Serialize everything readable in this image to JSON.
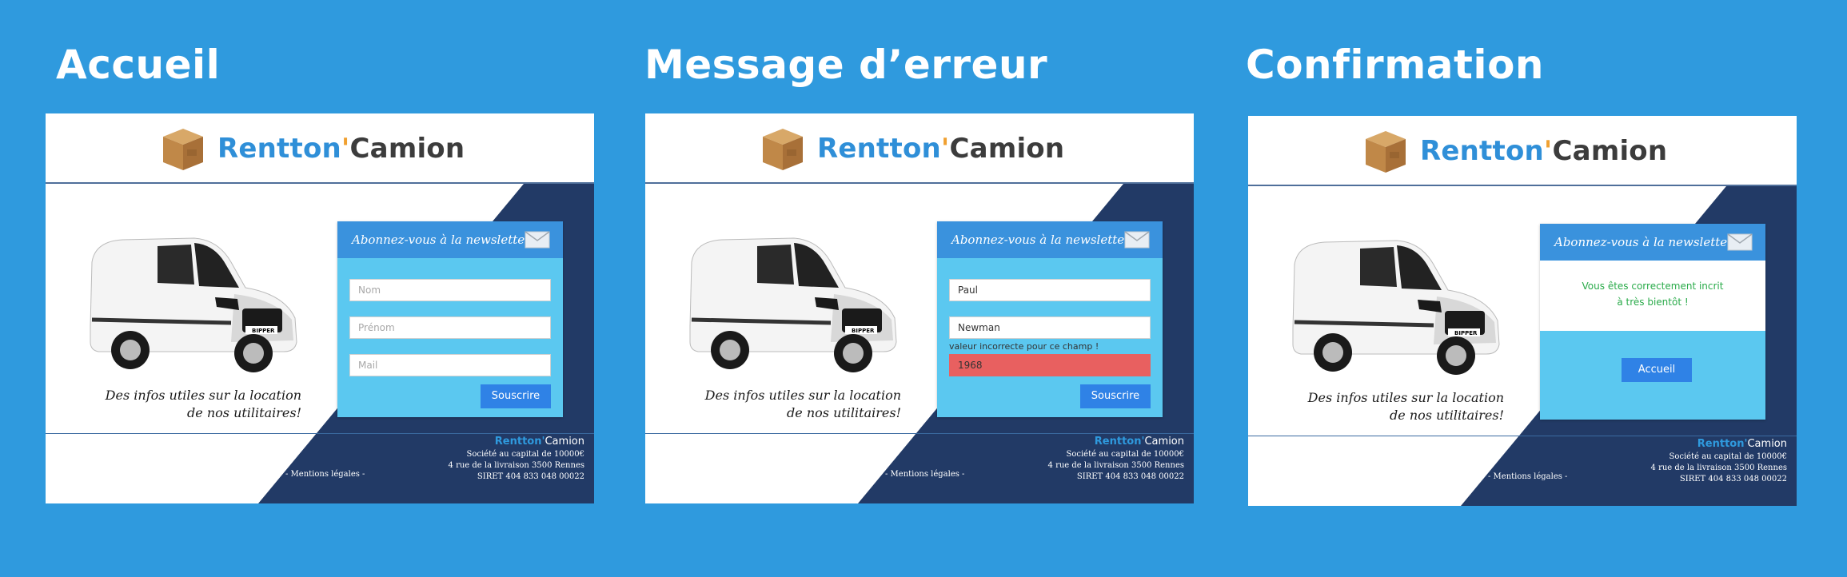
{
  "panels": [
    {
      "title": "Accueil",
      "brand": {
        "rent": "Rentton",
        "apos": "'",
        "camion": "Camion"
      },
      "tagline_line1": "Des infos utiles sur la location",
      "tagline_line2": "de nos utilitaires!",
      "newsletter_title": "Abonnez-vous à la newsletter",
      "fields": {
        "nom_placeholder": "Nom",
        "prenom_placeholder": "Prénom",
        "mail_placeholder": "Mail"
      },
      "submit_label": "Souscrire",
      "footer": {
        "capital": "Société au capital de 10000€",
        "address": "4 rue de la livraison 3500 Rennes",
        "siret": "SIRET 404 833 048 00022",
        "legal": "- Mentions légales -"
      }
    },
    {
      "title": "Message d’erreur",
      "brand": {
        "rent": "Rentton",
        "apos": "'",
        "camion": "Camion"
      },
      "tagline_line1": "Des infos utiles sur la location",
      "tagline_line2": "de nos utilitaires!",
      "newsletter_title": "Abonnez-vous à la newsletter",
      "fields": {
        "nom_value": "Paul",
        "prenom_value": "Newman",
        "error_message": "valeur incorrecte pour ce champ !",
        "mail_value": "1968"
      },
      "submit_label": "Souscrire",
      "footer": {
        "capital": "Société au capital de 10000€",
        "address": "4 rue de la livraison 3500 Rennes",
        "siret": "SIRET 404 833 048 00022",
        "legal": "- Mentions légales -"
      }
    },
    {
      "title": "Confirmation",
      "brand": {
        "rent": "Rentton",
        "apos": "'",
        "camion": "Camion"
      },
      "tagline_line1": "Des infos utiles sur la location",
      "tagline_line2": "de nos utilitaires!",
      "newsletter_title": "Abonnez-vous à la newsletter",
      "confirm_line1": "Vous êtes correctement incrit",
      "confirm_line2": "à très bientôt !",
      "home_label": "Accueil",
      "footer": {
        "capital": "Société au capital de 10000€",
        "address": "4 rue de la livraison 3500 Rennes",
        "siret": "SIRET 404 833 048 00022",
        "legal": "- Mentions légales -"
      }
    }
  ],
  "icons": {
    "logo": "cardboard-box-icon",
    "envelope": "envelope-icon",
    "van": "van-image"
  },
  "colors": {
    "page_bg": "#2f9ade",
    "navy": "#223a66",
    "brand_blue": "#2f8fd8",
    "header_blue": "#3a92dd",
    "form_bg": "#5bc8f0",
    "button": "#2f82e6",
    "error": "#e86060",
    "success": "#2aab4a"
  }
}
